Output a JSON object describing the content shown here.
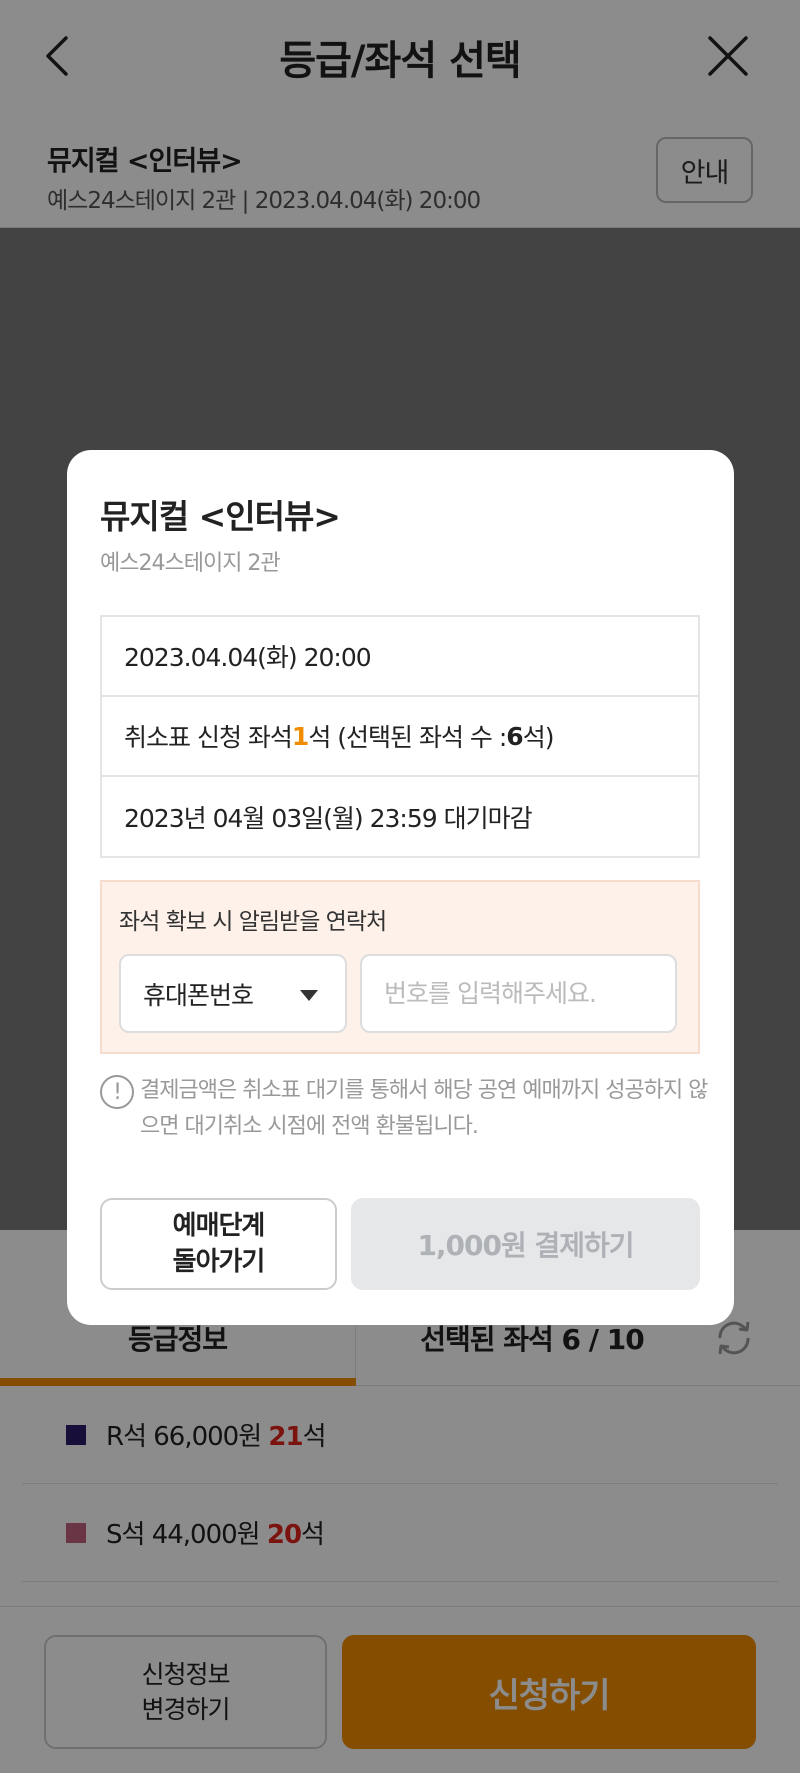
{
  "header": {
    "title": "등급/좌석 선택"
  },
  "show": {
    "title": "뮤지컬 <인터뷰>",
    "subtitle": "예스24스테이지 2관 | 2023.04.04(화) 20:00",
    "guide_label": "안내"
  },
  "tabs": {
    "grade_label": "등급정보",
    "seats_label": "선택된 좌석  6 / 10"
  },
  "grades": [
    {
      "prefix": "R석 66,000원 ",
      "count": "21",
      "suffix": "석",
      "color": "#2c1b6b"
    },
    {
      "prefix": "S석 44,000원 ",
      "count": "20",
      "suffix": "석",
      "color": "#c2617f"
    }
  ],
  "footer": {
    "change_label": "신청정보\n변경하기",
    "apply_label": "신청하기"
  },
  "modal": {
    "title": "뮤지컬 <인터뷰>",
    "venue": "예스24스테이지 2관",
    "date": "2023.04.04(화) 20:00",
    "seat_prefix": "취소표 신청 좌석 ",
    "seat_count": "1",
    "seat_mid": "석 (선택된 좌석 수 : ",
    "selected_count": "6",
    "seat_suffix": "석)",
    "deadline": "2023년 04월 03일(월) 23:59 대기마감",
    "contact_label": "좌석 확보 시 알림받을 연락처",
    "contact_type": "휴대폰번호",
    "phone_placeholder": "번호를 입력해주세요.",
    "notice_icon": "!",
    "notice": "결제금액은 취소표 대기를 통해서 해당 공연 예매까지 성공하지 않으면 대기취소 시점에 전액 환불됩니다.",
    "back_label": "예매단계\n돌아가기",
    "pay_label": "1,000원 결제하기"
  },
  "colors": {
    "accent": "#f08c00",
    "count_red": "#e0261c"
  }
}
